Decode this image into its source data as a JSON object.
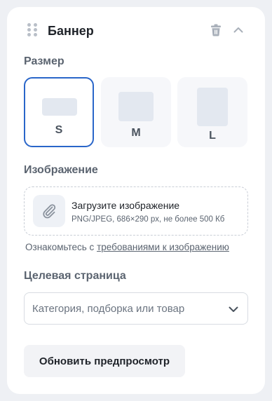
{
  "block": {
    "title": "Баннер",
    "icons": {
      "drag": "drag-handle-icon",
      "delete": "trash-icon",
      "collapse": "chevron-up-icon"
    }
  },
  "size": {
    "label": "Размер",
    "options": [
      {
        "label": "S",
        "selected": true
      },
      {
        "label": "M",
        "selected": false
      },
      {
        "label": "L",
        "selected": false
      }
    ],
    "accent": "#2a66c9"
  },
  "image": {
    "label": "Изображение",
    "upload_title": "Загрузите изображение",
    "upload_hint": "PNG/JPEG, 686×290 px, не более 500 Кб",
    "requirements_prefix": "Ознакомьтесь с ",
    "requirements_link": "требованиями к изображению",
    "icon": "paperclip-icon"
  },
  "target": {
    "label": "Целевая страница",
    "placeholder": "Категория, подборка или товар",
    "icon": "chevron-down-icon"
  },
  "actions": {
    "refresh_label": "Обновить предпросмотр"
  }
}
